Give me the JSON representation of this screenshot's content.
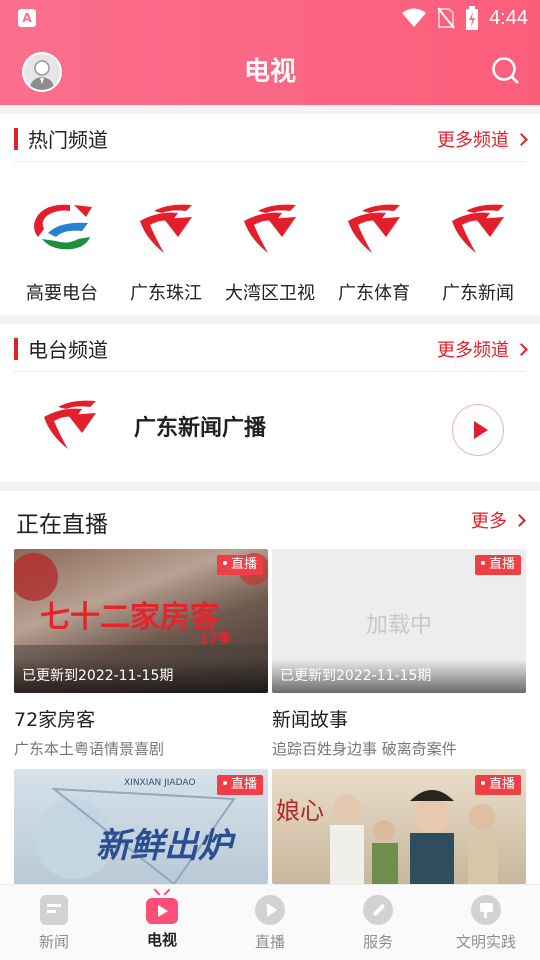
{
  "status_bar": {
    "time": "4:44",
    "app_glyph": "A"
  },
  "header": {
    "title": "电视"
  },
  "tv_section": {
    "title": "热门频道",
    "more": "更多频道",
    "channels": [
      {
        "label": "高要电台",
        "logo": "gaoyao-logo"
      },
      {
        "label": "广东珠江",
        "logo": "gdtv-logo"
      },
      {
        "label": "大湾区卫视",
        "logo": "gdtv-logo"
      },
      {
        "label": "广东体育",
        "logo": "gdtv-logo"
      },
      {
        "label": "广东新闻",
        "logo": "gdtv-logo"
      }
    ]
  },
  "radio_section": {
    "title": "电台频道",
    "more": "更多频道",
    "station": "广东新闻广播"
  },
  "live_section": {
    "title": "正在直播",
    "more": "更多",
    "cards": [
      {
        "badge": "直播",
        "updated": "已更新到2022-11-15期",
        "name": "72家房客",
        "desc": "广东本土粤语情景喜剧",
        "overlay": "七十二家房客",
        "overlay_sub": "17季"
      },
      {
        "badge": "直播",
        "updated": "已更新到2022-11-15期",
        "name": "新闻故事",
        "desc": "追踪百姓身边事 破离奇案件",
        "placeholder": "加载中"
      },
      {
        "badge": "直播",
        "overlay": "新鲜出炉",
        "overlay_sub": "XINXIAN JIADAO"
      },
      {
        "badge": "直播",
        "overlay": "娘心"
      }
    ]
  },
  "tabbar": {
    "tabs": [
      {
        "label": "新闻",
        "icon": "news-icon"
      },
      {
        "label": "电视",
        "icon": "tv-icon",
        "active": true
      },
      {
        "label": "直播",
        "icon": "live-play-icon"
      },
      {
        "label": "服务",
        "icon": "service-compass-icon"
      },
      {
        "label": "文明实践",
        "icon": "civilization-flag-icon"
      }
    ]
  },
  "colors": {
    "header_start": "#fb6f8d",
    "header_end": "#fb5e7a",
    "accent": "#e41f2c",
    "active_tab": "#ff4f78"
  }
}
